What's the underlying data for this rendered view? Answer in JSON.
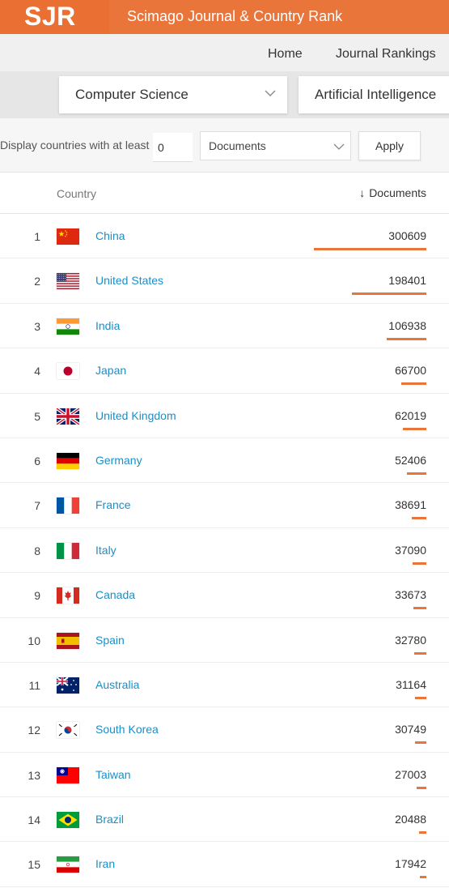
{
  "header": {
    "logo": "SJR",
    "title": "Scimago Journal & Country Rank"
  },
  "nav": {
    "home": "Home",
    "journal_rankings": "Journal Rankings"
  },
  "filters": {
    "subject_area": "Computer Science",
    "subject_category": "Artificial Intelligence",
    "min_label": "Display countries with at least",
    "min_value": "0",
    "metric": "Documents",
    "apply_label": "Apply"
  },
  "table": {
    "col_country": "Country",
    "col_documents": "Documents",
    "sort_icon": "arrow-down-icon",
    "accent_color": "#e9753a",
    "link_color": "#1a8fc8",
    "max_value": 300609,
    "rows": [
      {
        "rank": "1",
        "country": "China",
        "flag": "cn",
        "documents": 300609
      },
      {
        "rank": "2",
        "country": "United States",
        "flag": "us",
        "documents": 198401
      },
      {
        "rank": "3",
        "country": "India",
        "flag": "in",
        "documents": 106938
      },
      {
        "rank": "4",
        "country": "Japan",
        "flag": "jp",
        "documents": 66700
      },
      {
        "rank": "5",
        "country": "United Kingdom",
        "flag": "gb",
        "documents": 62019
      },
      {
        "rank": "6",
        "country": "Germany",
        "flag": "de",
        "documents": 52406
      },
      {
        "rank": "7",
        "country": "France",
        "flag": "fr",
        "documents": 38691
      },
      {
        "rank": "8",
        "country": "Italy",
        "flag": "it",
        "documents": 37090
      },
      {
        "rank": "9",
        "country": "Canada",
        "flag": "ca",
        "documents": 33673
      },
      {
        "rank": "10",
        "country": "Spain",
        "flag": "es",
        "documents": 32780
      },
      {
        "rank": "11",
        "country": "Australia",
        "flag": "au",
        "documents": 31164
      },
      {
        "rank": "12",
        "country": "South Korea",
        "flag": "kr",
        "documents": 30749
      },
      {
        "rank": "13",
        "country": "Taiwan",
        "flag": "tw",
        "documents": 27003
      },
      {
        "rank": "14",
        "country": "Brazil",
        "flag": "br",
        "documents": 20488
      },
      {
        "rank": "15",
        "country": "Iran",
        "flag": "ir",
        "documents": 17942
      }
    ]
  }
}
